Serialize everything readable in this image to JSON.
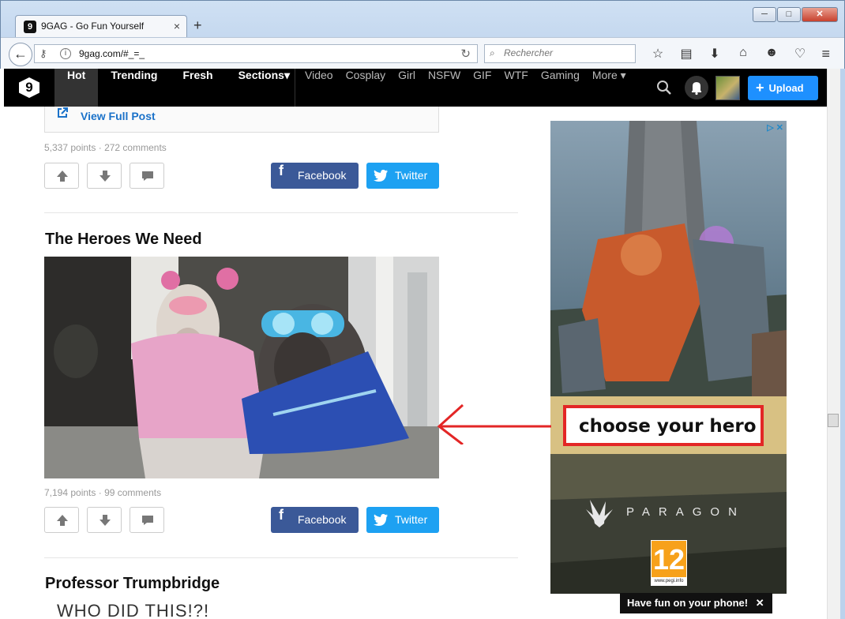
{
  "browser": {
    "tab_title": "9GAG - Go Fun Yourself",
    "tab_close": "×",
    "new_tab": "+",
    "url": "9gag.com/#_=_",
    "search_placeholder": "Rechercher",
    "window_controls": [
      "─",
      "□",
      "✕"
    ],
    "toolbar_icons": [
      "star-icon",
      "reading-list-icon",
      "download-icon",
      "home-icon",
      "smiley-icon",
      "pocket-icon"
    ],
    "menu_icon": "hamburger-menu-icon"
  },
  "site": {
    "logo_glyph": "9",
    "main_nav": [
      {
        "label": "Hot",
        "active": true
      },
      {
        "label": "Trending",
        "active": false
      },
      {
        "label": "Fresh",
        "active": false
      },
      {
        "label": "Sections",
        "active": false
      }
    ],
    "sections_caret": "▾",
    "section_links": [
      "Video",
      "Cosplay",
      "Girl",
      "NSFW",
      "GIF",
      "WTF",
      "Gaming",
      "More"
    ],
    "more_caret": "▾",
    "upload_label": "Upload",
    "upload_plus": "+",
    "colors": {
      "header": "#000000",
      "upload": "#1e90ff",
      "facebook": "#3b5998",
      "twitter": "#1da1f2",
      "link": "#1b72c9",
      "annotation": "#e32626"
    }
  },
  "feed": {
    "view_full_post": "View Full Post",
    "posts": [
      {
        "points": "5,337 points",
        "sep": "·",
        "comments": "272 comments",
        "facebook": "Facebook",
        "twitter": "Twitter"
      },
      {
        "title": "The Heroes We Need",
        "image": "two-dogs-in-capes-and-goggles",
        "points": "7,194 points",
        "sep": "·",
        "comments": "99 comments",
        "facebook": "Facebook",
        "twitter": "Twitter"
      },
      {
        "title": "Professor Trumpbridge",
        "teaser": "WHO DID THIS!?!"
      }
    ]
  },
  "ad": {
    "adchoices": "▷ ✕",
    "headline": "choose your hero",
    "brand": "PARAGON",
    "rating": "12",
    "rating_url": "www.pegi.info"
  },
  "toast": {
    "text": "Have fun on your phone!",
    "close": "✕"
  }
}
